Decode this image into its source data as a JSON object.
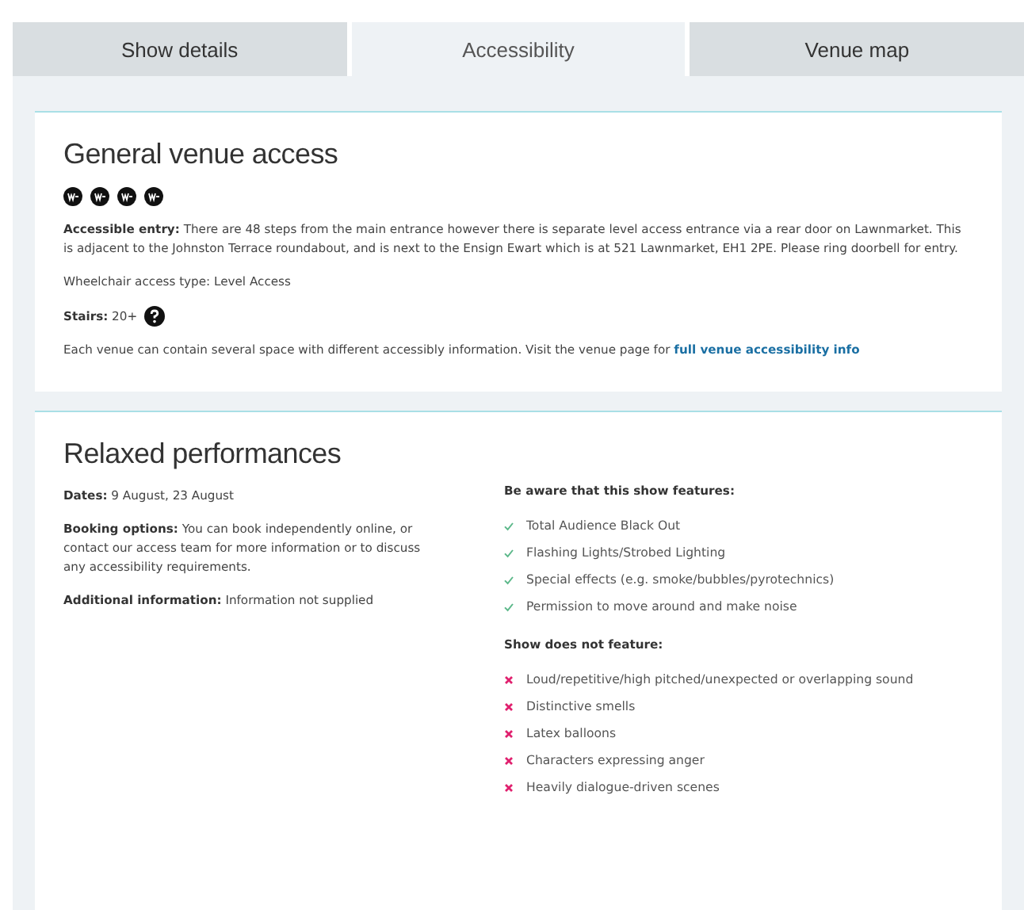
{
  "tabs": [
    {
      "label": "Show details",
      "selected": false
    },
    {
      "label": "Accessibility",
      "selected": true
    },
    {
      "label": "Venue map",
      "selected": false
    }
  ],
  "general_access": {
    "title": "General venue access",
    "paragraphs": [
      "**Accessible entry:** There are 48 steps from the main entrance however there is separate level access entrance via a rear door on Lawnmarket. This is adjacent to the Johnston Terrace roundabout, and is next to the Ensign Ewart which is at 521 Lawnmarket, EH1 2PE. Please ring doorbell for entry.",
      "Wheelchair access type: Level Access"
    ],
    "stairs": "**Stairs:** 20+",
    "note": "Each venue can contain several space with different accessibly information. Visit the venue page for",
    "note_link": "full venue accessibility info"
  },
  "relaxed_performances": {
    "title": "Relaxed performances",
    "details": [
      "**Dates:** 9 August, 23 August",
      "**Booking options:** You can book independently online, or contact our access team for more information or to discuss any accessibility requirements.",
      "**Additional information:** Information not supplied"
    ],
    "features_heading": "Be aware that this show features:",
    "features": [
      "Total Audience Black Out",
      "Flashing Lights/Strobed Lighting",
      "Special effects (e.g. smoke/bubbles/pyrotechnics)",
      "Permission to move around and make noise"
    ],
    "not_features_heading": "Show does not feature:",
    "not_features": [
      "Loud/repetitive/high pitched/unexpected or overlapping sound",
      "Distinctive smells",
      "Latex balloons",
      "Characters expressing anger",
      "Heavily dialogue-driven scenes"
    ]
  }
}
